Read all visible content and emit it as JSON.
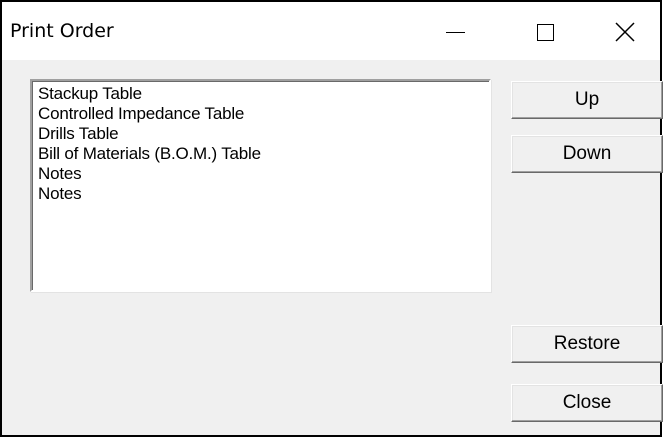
{
  "window": {
    "title": "Print Order",
    "controls": {
      "minimize_icon": "minimize-icon",
      "maximize_icon": "maximize-icon",
      "close_icon": "close-icon"
    }
  },
  "list": {
    "items": [
      "Stackup Table",
      "Controlled Impedance Table",
      "Drills Table",
      "Bill of Materials (B.O.M.) Table",
      "Notes",
      "Notes"
    ]
  },
  "buttons": {
    "up": "Up",
    "down": "Down",
    "restore": "Restore",
    "close": "Close"
  },
  "colors": {
    "dialog_background": "#f0f0f0",
    "titlebar_background": "#ffffff",
    "window_border": "#000000"
  }
}
